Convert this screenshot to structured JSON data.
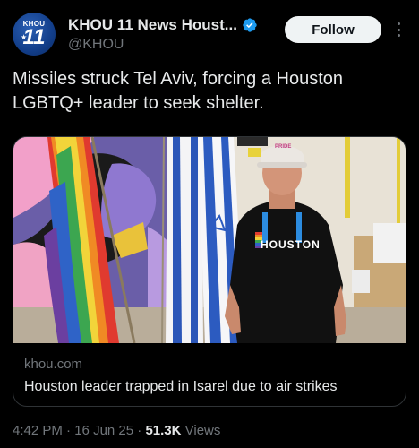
{
  "account": {
    "avatar_top": "KHOU",
    "avatar_num": "11",
    "name": "KHOU 11 News Houst...",
    "handle": "@KHOU",
    "verified_icon": "verified-badge-icon",
    "follow_label": "Follow"
  },
  "tweet": {
    "text": "Missiles struck Tel Aviv, forcing a Houston LGBTQ+ leader to seek shelter."
  },
  "card": {
    "domain": "khou.com",
    "title": "Houston leader trapped in Isarel due to air strikes",
    "shirt_text": "HOUSTON",
    "cap_text": "PRIDE"
  },
  "meta": {
    "time": "4:42 PM",
    "sep1": " · ",
    "date": "16 Jun 25",
    "sep2": " · ",
    "views": "51.3K",
    "views_label": " Views"
  },
  "colors": {
    "accent": "#1d9bf0",
    "follow_bg": "#eff3f4"
  }
}
